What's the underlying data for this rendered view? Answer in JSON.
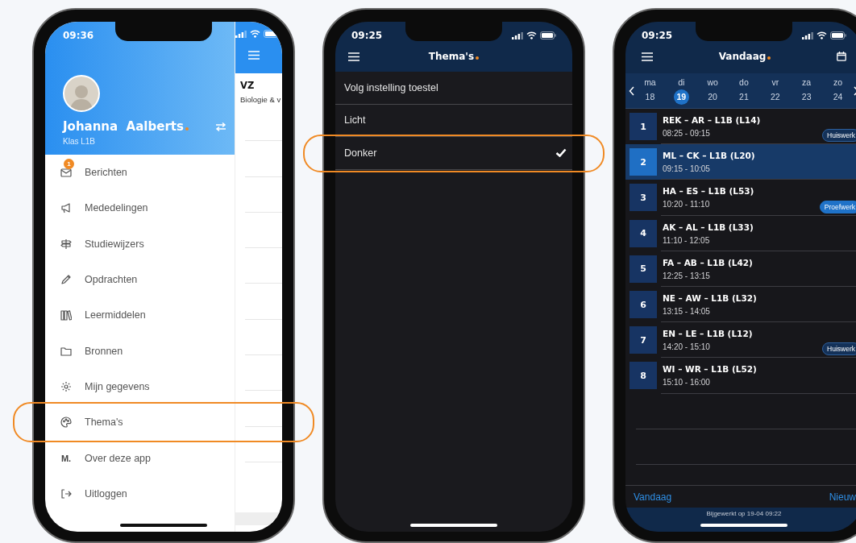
{
  "phones": [
    {
      "kind": "drawer",
      "status_bar": {
        "time": "09:36"
      },
      "profile": {
        "name": "Johanna  Aalberts",
        "class": "Klas L1B"
      },
      "menu": [
        {
          "label": "Berichten",
          "badge": "1",
          "highlighted": false
        },
        {
          "label": "Mededelingen",
          "highlighted": false
        },
        {
          "label": "Studiewijzers",
          "highlighted": false
        },
        {
          "label": "Opdrachten",
          "highlighted": false
        },
        {
          "label": "Leermiddelen",
          "highlighted": false
        },
        {
          "label": "Bronnen",
          "highlighted": false
        },
        {
          "label": "Mijn gegevens",
          "highlighted": false
        },
        {
          "label": "Thema's",
          "highlighted": true
        },
        {
          "label": "Over deze app",
          "icon_text": "M.",
          "highlighted": false
        },
        {
          "label": "Uitloggen",
          "highlighted": false
        }
      ],
      "background_page": {
        "title": "VZ",
        "subtitle": "Biologie & v"
      }
    },
    {
      "kind": "themes",
      "status_bar": {
        "time": "09:25"
      },
      "title": "Thema's",
      "options": [
        {
          "label": "Volg instelling toestel",
          "selected": false,
          "highlighted": false
        },
        {
          "label": "Licht",
          "selected": false,
          "highlighted": false
        },
        {
          "label": "Donker",
          "selected": true,
          "highlighted": true
        }
      ]
    },
    {
      "kind": "agenda",
      "status_bar": {
        "time": "09:25"
      },
      "title": "Vandaag",
      "days": [
        {
          "weekday": "ma",
          "date": "18",
          "selected": false
        },
        {
          "weekday": "di",
          "date": "19",
          "selected": true
        },
        {
          "weekday": "wo",
          "date": "20",
          "selected": false
        },
        {
          "weekday": "do",
          "date": "21",
          "selected": false
        },
        {
          "weekday": "vr",
          "date": "22",
          "selected": false
        },
        {
          "weekday": "za",
          "date": "23",
          "selected": false
        },
        {
          "weekday": "zo",
          "date": "24",
          "selected": false
        }
      ],
      "lessons": [
        {
          "hour": "1",
          "title": "REK – AR – L1B (L14)",
          "time": "08:25 - 09:15",
          "selected": false,
          "badge": {
            "label": "Huiswerk",
            "kind": "homework"
          }
        },
        {
          "hour": "2",
          "title": "ML – CK – L1B (L20)",
          "time": "09:15 - 10:05",
          "selected": true
        },
        {
          "hour": "3",
          "title": "HA – ES – L1B (L53)",
          "time": "10:20 - 11:10",
          "selected": false,
          "badge": {
            "label": "Proefwerk",
            "kind": "test"
          }
        },
        {
          "hour": "4",
          "title": "AK – AL – L1B (L33)",
          "time": "11:10 - 12:05",
          "selected": false
        },
        {
          "hour": "5",
          "title": "FA – AB – L1B (L42)",
          "time": "12:25 - 13:15",
          "selected": false
        },
        {
          "hour": "6",
          "title": "NE – AW – L1B (L32)",
          "time": "13:15 - 14:05",
          "selected": false
        },
        {
          "hour": "7",
          "title": "EN – LE – L1B (L12)",
          "time": "14:20 - 15:10",
          "selected": false,
          "badge": {
            "label": "Huiswerk",
            "kind": "homework"
          }
        },
        {
          "hour": "8",
          "title": "WI – WR – L1B (L52)",
          "time": "15:10 - 16:00",
          "selected": false
        }
      ],
      "footer_actions": [
        "Vandaag",
        "Nieuw"
      ],
      "updated": "Bijgewerkt op 19-04 09:22"
    }
  ]
}
